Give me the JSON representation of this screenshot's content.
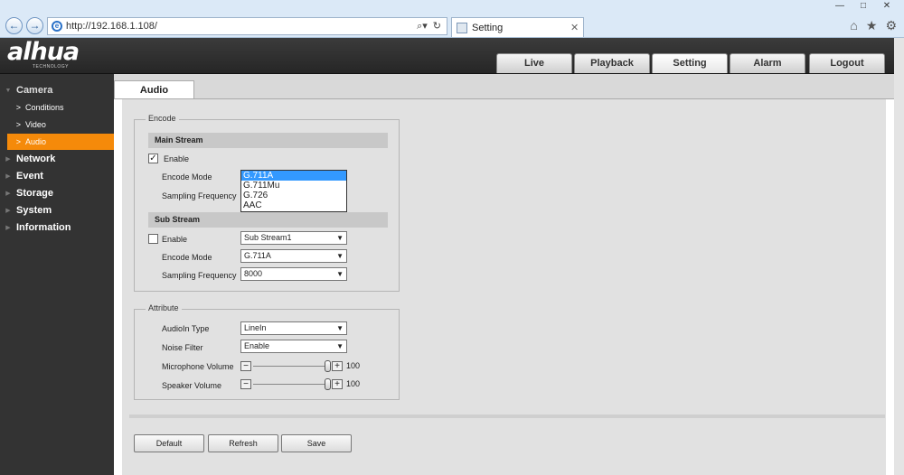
{
  "browser": {
    "url": "http://192.168.1.108/",
    "tab_title": "Setting",
    "window_buttons": [
      "—",
      "□",
      "✕"
    ]
  },
  "brand": {
    "logo": "alhua",
    "logo_sub": "TECHNOLOGY"
  },
  "top_tabs": [
    "Live",
    "Playback",
    "Setting",
    "Alarm",
    "Logout"
  ],
  "sidebar": {
    "sections": [
      "Camera",
      "Network",
      "Event",
      "Storage",
      "System",
      "Information"
    ],
    "camera_items": [
      "Conditions",
      "Video",
      "Audio"
    ]
  },
  "page": {
    "tab": "Audio",
    "encode": {
      "legend": "Encode",
      "main_stream": {
        "title": "Main Stream",
        "enable_label": "Enable",
        "enable_checked": true,
        "encode_mode_label": "Encode Mode",
        "sampling_label": "Sampling Frequency",
        "encode_options": [
          "G.711A",
          "G.711Mu",
          "G.726",
          "AAC"
        ],
        "selected_option": "G.711A"
      },
      "sub_stream": {
        "title": "Sub Stream",
        "enable_label": "Enable",
        "enable_checked": false,
        "stream_select": "Sub Stream1",
        "encode_mode_label": "Encode Mode",
        "encode_mode": "G.711A",
        "sampling_label": "Sampling Frequency",
        "sampling": "8000"
      }
    },
    "attribute": {
      "legend": "Attribute",
      "audioin_label": "AudioIn Type",
      "audioin": "LineIn",
      "noise_label": "Noise Filter",
      "noise": "Enable",
      "mic_label": "Microphone Volume",
      "mic_value": "100",
      "speaker_label": "Speaker Volume",
      "speaker_value": "100"
    },
    "buttons": {
      "default": "Default",
      "refresh": "Refresh",
      "save": "Save"
    }
  }
}
